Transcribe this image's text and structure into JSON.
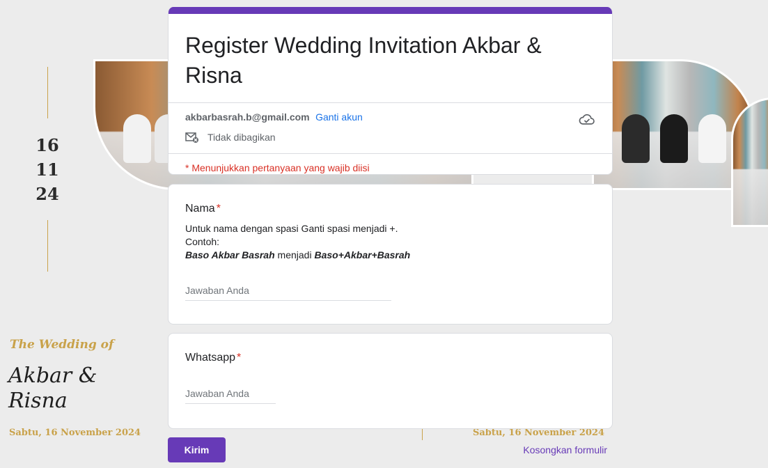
{
  "decor": {
    "day": "16",
    "month": "11",
    "year": "24",
    "wedding_of": "The Wedding of",
    "couple": "Akbar & Risna",
    "date_left": "Sabtu, 16 November 2024",
    "date_right": "Sabtu, 16 November 2024"
  },
  "form": {
    "title": "Register Wedding Invitation Akbar & Risna",
    "account_email": "akbarbasrah.b@gmail.com",
    "switch_account": "Ganti akun",
    "not_shared": "Tidak dibagikan",
    "required_note": "* Menunjukkan pertanyaan yang wajib diisi",
    "accent_color": "#673ab7"
  },
  "questions": {
    "name": {
      "title": "Nama",
      "required_mark": "*",
      "desc_line1": "Untuk nama dengan spasi Ganti spasi menjadi +.",
      "desc_line2": "Contoh:",
      "example_from": "Baso Akbar Basrah",
      "example_mid": "menjadi",
      "example_to": "Baso+Akbar+Basrah",
      "placeholder": "Jawaban Anda"
    },
    "whatsapp": {
      "title": "Whatsapp",
      "required_mark": "*",
      "placeholder": "Jawaban Anda"
    }
  },
  "actions": {
    "submit": "Kirim",
    "clear": "Kosongkan formulir"
  }
}
